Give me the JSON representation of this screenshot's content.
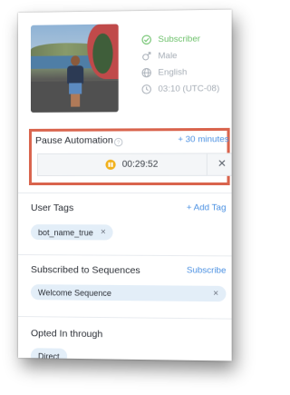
{
  "profile": {
    "status": "Subscriber",
    "gender": "Male",
    "language": "English",
    "time": "03:10 (UTC-08)"
  },
  "pause_automation": {
    "title": "Pause Automation",
    "help_icon": "question-circle-icon",
    "extend_link": "+ 30 minutes",
    "timer": "00:29:52",
    "timer_icon": "pause-circle-icon",
    "close_icon": "close-icon"
  },
  "user_tags": {
    "title": "User Tags",
    "add_link": "+ Add Tag",
    "tags": [
      "bot_name_true"
    ]
  },
  "sequences": {
    "title": "Subscribed to Sequences",
    "subscribe_link": "Subscribe",
    "items": [
      "Welcome Sequence"
    ]
  },
  "opted_in": {
    "title": "Opted In through",
    "source": "Direct"
  },
  "colors": {
    "accent": "#4a90e2",
    "subscriber_green": "#6cc16a",
    "highlight_border": "#d9644d",
    "pause_yellow": "#f1b11c"
  }
}
